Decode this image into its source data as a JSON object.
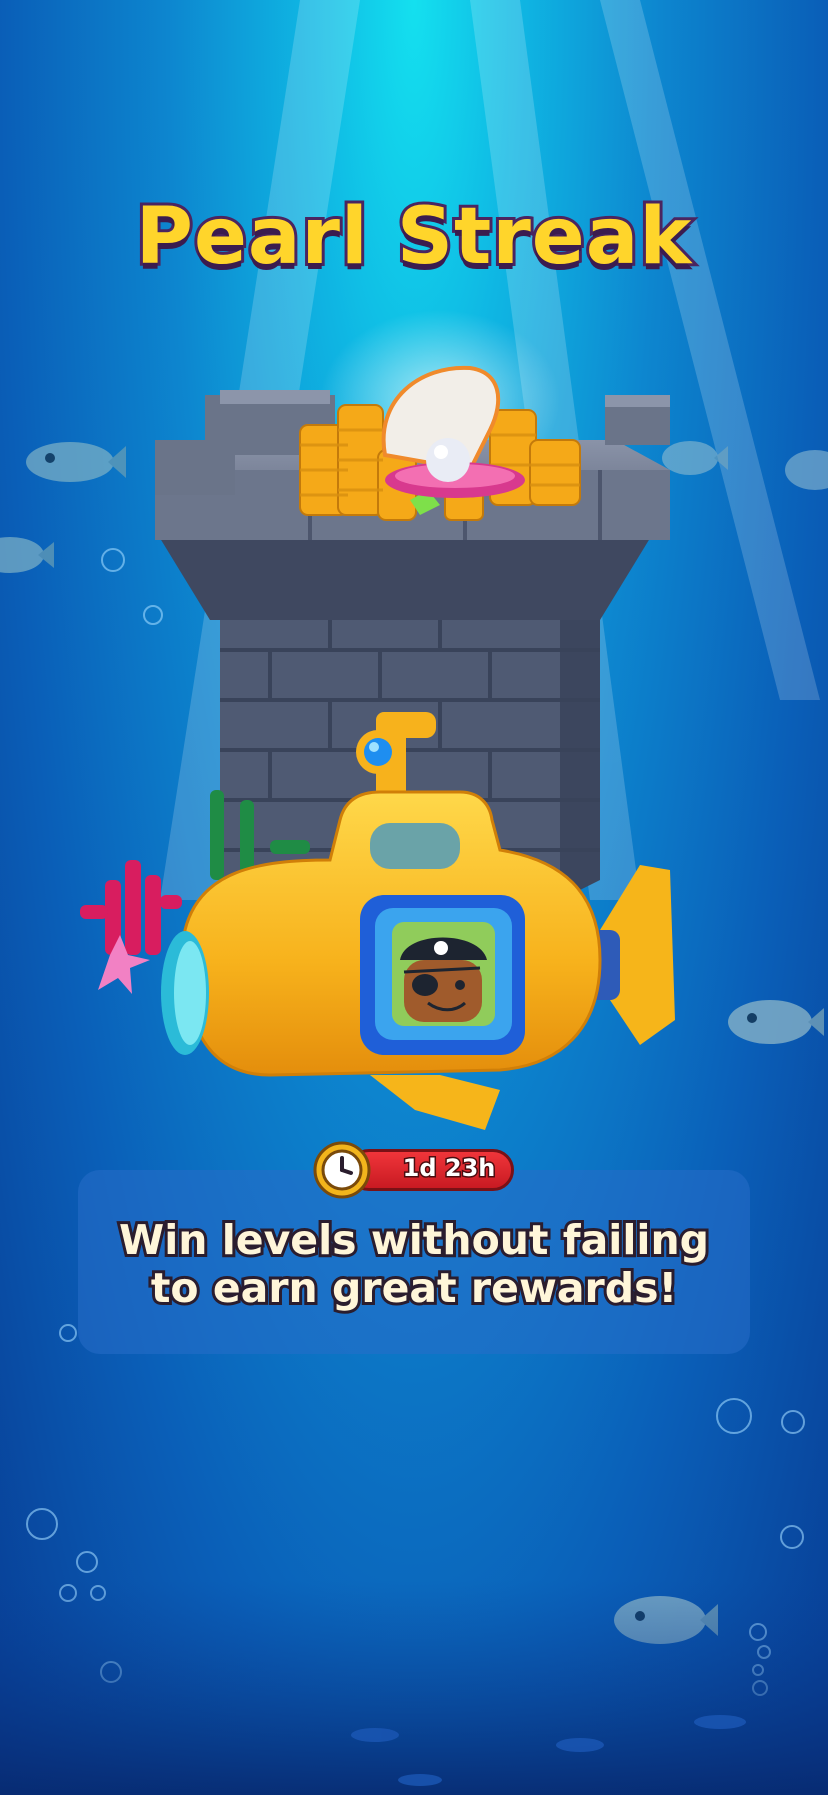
{
  "event": {
    "title": "Pearl Streak",
    "timer_text": "1d 23h",
    "description_line1": "Win levels without failing",
    "description_line2": "to earn great rewards!"
  },
  "icons": {
    "timer": "clock-icon",
    "reward": "pearl-in-shell-icon"
  },
  "colors": {
    "title_fill": "#ffd52b",
    "title_outline": "#4a2560",
    "timer_pill": "#e52a30",
    "water_top": "#14e0ef",
    "water_bottom": "#083d94"
  }
}
